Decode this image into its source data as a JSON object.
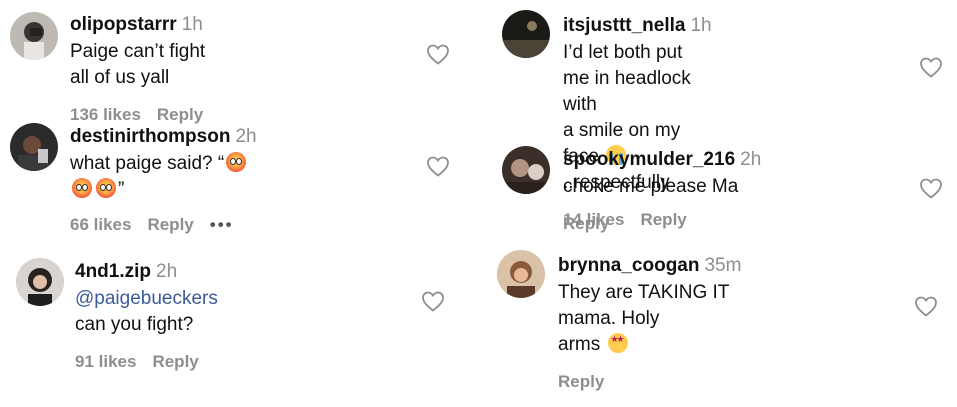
{
  "comments": [
    {
      "user": "olipopstarrr",
      "time": "1h",
      "text": "Paige can’t fight all of us yall",
      "likes": "136 likes",
      "reply": "Reply"
    },
    {
      "user": "destinirthompson",
      "time": "2h",
      "text_before": "what paige said? “",
      "text_after": "”",
      "emojis": [
        "hot-face",
        "hot-face",
        "hot-face"
      ],
      "likes": "66 likes",
      "reply": "Reply",
      "more": "•••"
    },
    {
      "user": "4nd1.zip",
      "time": "2h",
      "mention": "@paigebueckers",
      "text": " can you fight?",
      "likes": "91 likes",
      "reply": "Reply"
    },
    {
      "user": "itsjusttt_nella",
      "time": "1h",
      "text_line1": "I’d let both put me in headlock with",
      "text_line2_before": "a smile on my face ",
      "emoji": "crying-face",
      "text_line2_after": " ..respectfully",
      "likes": "14 likes",
      "reply": "Reply"
    },
    {
      "user": "spookymulder_216",
      "time": "2h",
      "text": "choke me please Ma",
      "reply": "Reply"
    },
    {
      "user": "brynna_coogan",
      "time": "35m",
      "text_line1": "They are TAKING IT mama. Holy",
      "text_line2_before": "arms ",
      "emoji": "star-struck",
      "reply": "Reply"
    }
  ],
  "icons": {
    "like": "heart-outline-icon",
    "more": "more-horizontal-icon"
  },
  "colors": {
    "mention": "#3d5b9a",
    "muted": "#8e8e8e"
  }
}
